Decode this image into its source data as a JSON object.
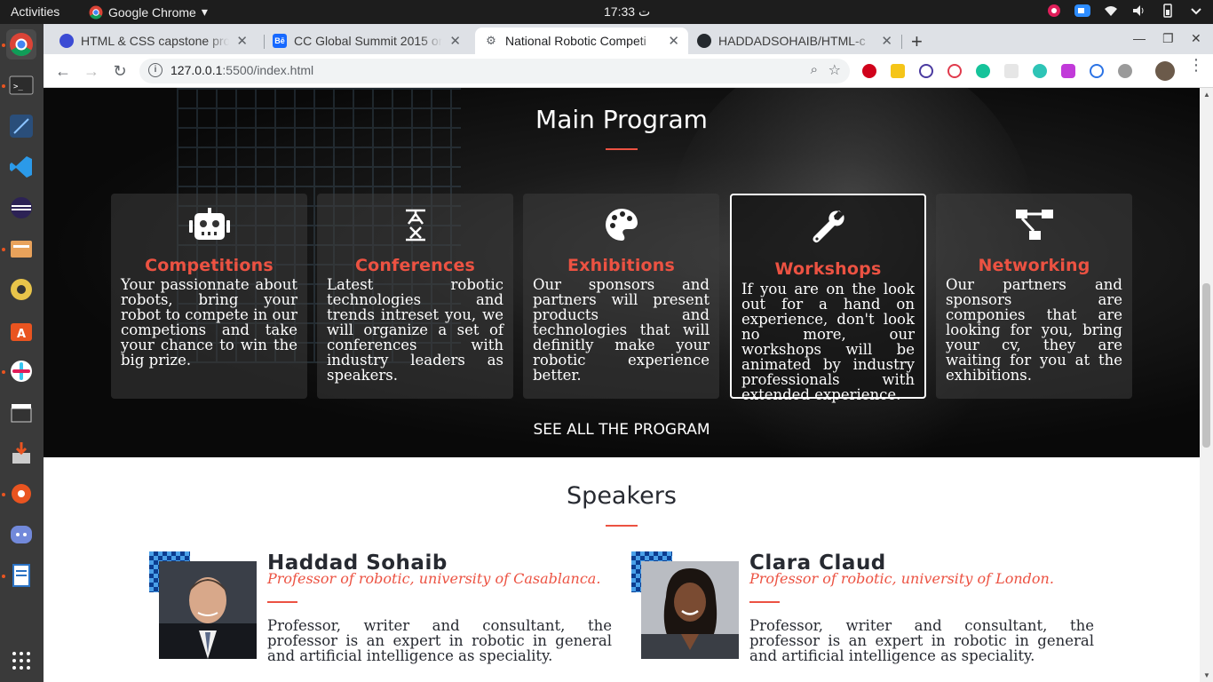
{
  "os": {
    "activities": "Activities",
    "app_name": "Google Chrome",
    "clock": "17:33 ت"
  },
  "browser": {
    "tabs": [
      {
        "title": "HTML & CSS capstone pro",
        "active": false
      },
      {
        "title": "CC Global Summit 2015 on",
        "active": false
      },
      {
        "title": "National Robotic Competi",
        "active": true
      },
      {
        "title": "HADDADSOHAIB/HTML-c",
        "active": false
      }
    ],
    "url_host": "127.0.0.1",
    "url_rest": ":5500/index.html"
  },
  "program": {
    "title": "Main Program",
    "cards": [
      {
        "icon": "robot-icon",
        "title": "Competitions",
        "text": "Your passionnate about robots, bring your robot to compete in our competions and take your chance to win the big prize."
      },
      {
        "icon": "translate-icon",
        "title": "Conferences",
        "text": "Latest robotic technologies and trends intreset you, we will organize a set of conferences with industry leaders as speakers."
      },
      {
        "icon": "palette-icon",
        "title": "Exhibitions",
        "text": "Our sponsors and partners will present products and technologies that will definitly make your robotic experience better."
      },
      {
        "icon": "wrench-icon",
        "title": "Workshops",
        "text": "If you are on the look out for a hand on experience, don't look no more, our workshops will be animated by industry professionals with extended experience."
      },
      {
        "icon": "network-icon",
        "title": "Networking",
        "text": "Our partners and sponsors are componies that are looking for you, bring your cv, they are waiting for you at the exhibitions."
      }
    ],
    "see_all": "SEE ALL THE PROGRAM"
  },
  "speakers": {
    "title": "Speakers",
    "items": [
      {
        "name": "Haddad Sohaib",
        "role": "Professor of robotic, university of Casablanca.",
        "desc": "Professor, writer and consultant, the professor is an expert in robotic in general and artificial intelligence as speciality."
      },
      {
        "name": "Clara Claud",
        "role": "Professor of robotic, university of London.",
        "desc": "Professor, writer and consultant, the professor is an expert in robotic in general and artificial intelligence as speciality."
      }
    ]
  },
  "colors": {
    "accent": "#ec5242",
    "dark_text": "#272a31"
  }
}
